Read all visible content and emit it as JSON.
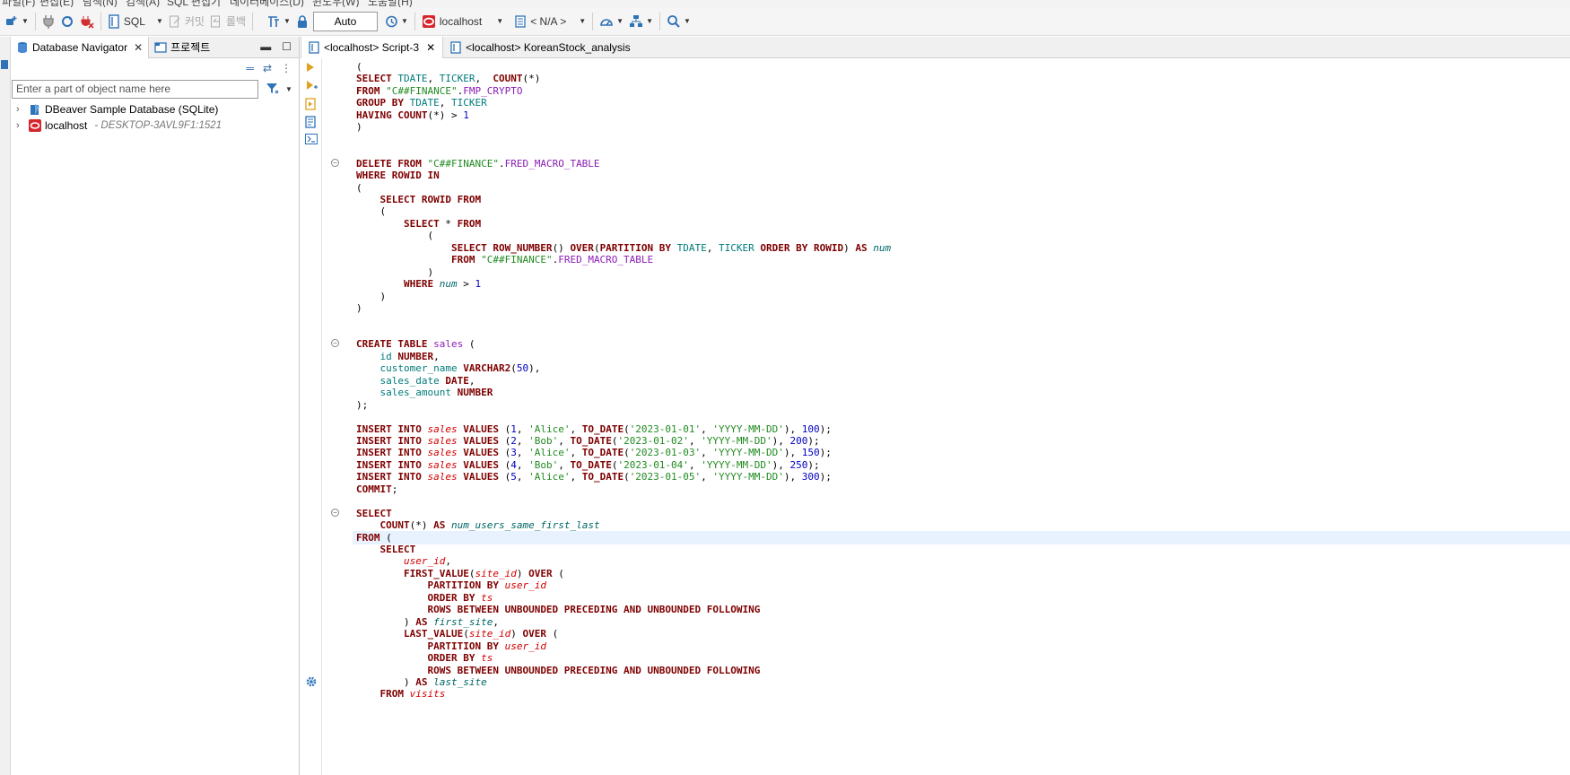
{
  "menubar": {
    "items": [
      "파일(F)",
      "편집(E)",
      "탐색(N)",
      "검색(A)",
      "SQL 편집기",
      "데이터베이스(D)",
      "윈도우(W)",
      "도움말(H)"
    ]
  },
  "toolbar": {
    "sql_label": "SQL",
    "commit_label": "커밋",
    "rollback_label": "롤백",
    "auto_label": "Auto",
    "connection_label": "localhost",
    "schema_label": "< N/A >"
  },
  "navigator": {
    "tab_db": "Database Navigator",
    "tab_projects": "프로젝트",
    "filter_placeholder": "Enter a part of object name here",
    "tree": [
      {
        "label": "DBeaver Sample Database (SQLite)",
        "sub": ""
      },
      {
        "label": "localhost",
        "sub": "- DESKTOP-3AVL9F1:1521"
      }
    ]
  },
  "editor": {
    "tabs": [
      {
        "label": "<localhost> Script-3",
        "active": true
      },
      {
        "label": "<localhost> KoreanStock_analysis",
        "active": false
      }
    ],
    "code_lines": [
      [
        [
          "p",
          "("
        ]
      ],
      [
        [
          "k",
          "SELECT "
        ],
        [
          "c",
          "TDATE"
        ],
        [
          "p",
          ", "
        ],
        [
          "c",
          "TICKER"
        ],
        [
          "p",
          ",  "
        ],
        [
          "k",
          "COUNT"
        ],
        [
          "p",
          "(*)"
        ]
      ],
      [
        [
          "k",
          "FROM "
        ],
        [
          "s",
          "\"C##FINANCE\""
        ],
        [
          "p",
          "."
        ],
        [
          "t",
          "FMP_CRYPTO"
        ]
      ],
      [
        [
          "k",
          "GROUP BY "
        ],
        [
          "c",
          "TDATE"
        ],
        [
          "p",
          ", "
        ],
        [
          "c",
          "TICKER"
        ]
      ],
      [
        [
          "k",
          "HAVING "
        ],
        [
          "k",
          "COUNT"
        ],
        [
          "p",
          "(*) > "
        ],
        [
          "n",
          "1"
        ]
      ],
      [
        [
          "p",
          ")"
        ]
      ],
      [],
      [],
      [
        [
          "k",
          "DELETE FROM "
        ],
        [
          "s",
          "\"C##FINANCE\""
        ],
        [
          "p",
          "."
        ],
        [
          "t",
          "FRED_MACRO_TABLE"
        ]
      ],
      [
        [
          "k",
          "WHERE "
        ],
        [
          "k",
          "ROWID "
        ],
        [
          "k",
          "IN"
        ]
      ],
      [
        [
          "p",
          "("
        ]
      ],
      [
        [
          "p",
          "    "
        ],
        [
          "k",
          "SELECT "
        ],
        [
          "k",
          "ROWID "
        ],
        [
          "k",
          "FROM"
        ]
      ],
      [
        [
          "p",
          "    ("
        ]
      ],
      [
        [
          "p",
          "        "
        ],
        [
          "k",
          "SELECT "
        ],
        [
          "p",
          "* "
        ],
        [
          "k",
          "FROM"
        ]
      ],
      [
        [
          "p",
          "            ("
        ]
      ],
      [
        [
          "p",
          "                "
        ],
        [
          "k",
          "SELECT "
        ],
        [
          "k",
          "ROW_NUMBER"
        ],
        [
          "p",
          "() "
        ],
        [
          "k",
          "OVER"
        ],
        [
          "p",
          "("
        ],
        [
          "k",
          "PARTITION BY "
        ],
        [
          "c",
          "TDATE"
        ],
        [
          "p",
          ", "
        ],
        [
          "c",
          "TICKER "
        ],
        [
          "k",
          "ORDER BY "
        ],
        [
          "k",
          "ROWID"
        ],
        [
          "p",
          ") "
        ],
        [
          "k",
          "AS "
        ],
        [
          "a",
          "num"
        ]
      ],
      [
        [
          "p",
          "                "
        ],
        [
          "k",
          "FROM "
        ],
        [
          "s",
          "\"C##FINANCE\""
        ],
        [
          "p",
          "."
        ],
        [
          "t",
          "FRED_MACRO_TABLE"
        ]
      ],
      [
        [
          "p",
          "            )"
        ]
      ],
      [
        [
          "p",
          "        "
        ],
        [
          "k",
          "WHERE "
        ],
        [
          "a",
          "num"
        ],
        [
          "p",
          " > "
        ],
        [
          "n",
          "1"
        ]
      ],
      [
        [
          "p",
          "    )"
        ]
      ],
      [
        [
          "p",
          ")"
        ]
      ],
      [],
      [],
      [
        [
          "k",
          "CREATE TABLE "
        ],
        [
          "t",
          "sales "
        ],
        [
          "p",
          "("
        ]
      ],
      [
        [
          "p",
          "    "
        ],
        [
          "c",
          "id "
        ],
        [
          "k",
          "NUMBER"
        ],
        [
          "p",
          ","
        ]
      ],
      [
        [
          "p",
          "    "
        ],
        [
          "c",
          "customer_name "
        ],
        [
          "k",
          "VARCHAR2"
        ],
        [
          "p",
          "("
        ],
        [
          "n",
          "50"
        ],
        [
          "p",
          "),"
        ]
      ],
      [
        [
          "p",
          "    "
        ],
        [
          "c",
          "sales_date "
        ],
        [
          "k",
          "DATE"
        ],
        [
          "p",
          ","
        ]
      ],
      [
        [
          "p",
          "    "
        ],
        [
          "c",
          "sales_amount "
        ],
        [
          "k",
          "NUMBER"
        ]
      ],
      [
        [
          "p",
          ");"
        ]
      ],
      [],
      [
        [
          "k",
          "INSERT INTO "
        ],
        [
          "v",
          "sales "
        ],
        [
          "k",
          "VALUES "
        ],
        [
          "p",
          "("
        ],
        [
          "n",
          "1"
        ],
        [
          "p",
          ", "
        ],
        [
          "s",
          "'Alice'"
        ],
        [
          "p",
          ", "
        ],
        [
          "k",
          "TO_DATE"
        ],
        [
          "p",
          "("
        ],
        [
          "s",
          "'2023-01-01'"
        ],
        [
          "p",
          ", "
        ],
        [
          "s",
          "'YYYY-MM-DD'"
        ],
        [
          "p",
          "), "
        ],
        [
          "n",
          "100"
        ],
        [
          "p",
          ");"
        ]
      ],
      [
        [
          "k",
          "INSERT INTO "
        ],
        [
          "v",
          "sales "
        ],
        [
          "k",
          "VALUES "
        ],
        [
          "p",
          "("
        ],
        [
          "n",
          "2"
        ],
        [
          "p",
          ", "
        ],
        [
          "s",
          "'Bob'"
        ],
        [
          "p",
          ", "
        ],
        [
          "k",
          "TO_DATE"
        ],
        [
          "p",
          "("
        ],
        [
          "s",
          "'2023-01-02'"
        ],
        [
          "p",
          ", "
        ],
        [
          "s",
          "'YYYY-MM-DD'"
        ],
        [
          "p",
          "), "
        ],
        [
          "n",
          "200"
        ],
        [
          "p",
          ");"
        ]
      ],
      [
        [
          "k",
          "INSERT INTO "
        ],
        [
          "v",
          "sales "
        ],
        [
          "k",
          "VALUES "
        ],
        [
          "p",
          "("
        ],
        [
          "n",
          "3"
        ],
        [
          "p",
          ", "
        ],
        [
          "s",
          "'Alice'"
        ],
        [
          "p",
          ", "
        ],
        [
          "k",
          "TO_DATE"
        ],
        [
          "p",
          "("
        ],
        [
          "s",
          "'2023-01-03'"
        ],
        [
          "p",
          ", "
        ],
        [
          "s",
          "'YYYY-MM-DD'"
        ],
        [
          "p",
          "), "
        ],
        [
          "n",
          "150"
        ],
        [
          "p",
          ");"
        ]
      ],
      [
        [
          "k",
          "INSERT INTO "
        ],
        [
          "v",
          "sales "
        ],
        [
          "k",
          "VALUES "
        ],
        [
          "p",
          "("
        ],
        [
          "n",
          "4"
        ],
        [
          "p",
          ", "
        ],
        [
          "s",
          "'Bob'"
        ],
        [
          "p",
          ", "
        ],
        [
          "k",
          "TO_DATE"
        ],
        [
          "p",
          "("
        ],
        [
          "s",
          "'2023-01-04'"
        ],
        [
          "p",
          ", "
        ],
        [
          "s",
          "'YYYY-MM-DD'"
        ],
        [
          "p",
          "), "
        ],
        [
          "n",
          "250"
        ],
        [
          "p",
          ");"
        ]
      ],
      [
        [
          "k",
          "INSERT INTO "
        ],
        [
          "v",
          "sales "
        ],
        [
          "k",
          "VALUES "
        ],
        [
          "p",
          "("
        ],
        [
          "n",
          "5"
        ],
        [
          "p",
          ", "
        ],
        [
          "s",
          "'Alice'"
        ],
        [
          "p",
          ", "
        ],
        [
          "k",
          "TO_DATE"
        ],
        [
          "p",
          "("
        ],
        [
          "s",
          "'2023-01-05'"
        ],
        [
          "p",
          ", "
        ],
        [
          "s",
          "'YYYY-MM-DD'"
        ],
        [
          "p",
          "), "
        ],
        [
          "n",
          "300"
        ],
        [
          "p",
          ");"
        ]
      ],
      [
        [
          "k",
          "COMMIT"
        ],
        [
          "p",
          ";"
        ]
      ],
      [],
      [
        [
          "k",
          "SELECT"
        ]
      ],
      [
        [
          "p",
          "    "
        ],
        [
          "k",
          "COUNT"
        ],
        [
          "p",
          "(*) "
        ],
        [
          "k",
          "AS "
        ],
        [
          "a",
          "num_users_same_first_last"
        ]
      ],
      [
        [
          "k",
          "FROM "
        ],
        [
          "p",
          "("
        ]
      ],
      [
        [
          "p",
          "    "
        ],
        [
          "k",
          "SELECT"
        ]
      ],
      [
        [
          "p",
          "        "
        ],
        [
          "v",
          "user_id"
        ],
        [
          "p",
          ","
        ]
      ],
      [
        [
          "p",
          "        "
        ],
        [
          "k",
          "FIRST_VALUE"
        ],
        [
          "p",
          "("
        ],
        [
          "v",
          "site_id"
        ],
        [
          "p",
          ") "
        ],
        [
          "k",
          "OVER "
        ],
        [
          "p",
          "("
        ]
      ],
      [
        [
          "p",
          "            "
        ],
        [
          "k",
          "PARTITION BY "
        ],
        [
          "v",
          "user_id"
        ]
      ],
      [
        [
          "p",
          "            "
        ],
        [
          "k",
          "ORDER BY "
        ],
        [
          "v",
          "ts"
        ]
      ],
      [
        [
          "p",
          "            "
        ],
        [
          "k",
          "ROWS BETWEEN UNBOUNDED PRECEDING AND UNBOUNDED FOLLOWING"
        ]
      ],
      [
        [
          "p",
          "        ) "
        ],
        [
          "k",
          "AS "
        ],
        [
          "a",
          "first_site"
        ],
        [
          "p",
          ","
        ]
      ],
      [
        [
          "p",
          "        "
        ],
        [
          "k",
          "LAST_VALUE"
        ],
        [
          "p",
          "("
        ],
        [
          "v",
          "site_id"
        ],
        [
          "p",
          ") "
        ],
        [
          "k",
          "OVER "
        ],
        [
          "p",
          "("
        ]
      ],
      [
        [
          "p",
          "            "
        ],
        [
          "k",
          "PARTITION BY "
        ],
        [
          "v",
          "user_id"
        ]
      ],
      [
        [
          "p",
          "            "
        ],
        [
          "k",
          "ORDER BY "
        ],
        [
          "v",
          "ts"
        ]
      ],
      [
        [
          "p",
          "            "
        ],
        [
          "k",
          "ROWS BETWEEN UNBOUNDED PRECEDING AND UNBOUNDED FOLLOWING"
        ]
      ],
      [
        [
          "p",
          "        ) "
        ],
        [
          "k",
          "AS "
        ],
        [
          "a",
          "last_site"
        ]
      ],
      [
        [
          "p",
          "    "
        ],
        [
          "k",
          "FROM "
        ],
        [
          "v",
          "visits"
        ]
      ]
    ],
    "fold_lines": [
      8,
      23,
      37
    ],
    "current_line": 39
  },
  "colors": {
    "keyword": "#7f0000",
    "string": "#228b22",
    "number": "#0000c0",
    "table": "#8a1cb5",
    "column": "#007a7a",
    "variable": "#d40000",
    "alias": "#006666",
    "current_line_bg": "#e8f2fe"
  }
}
